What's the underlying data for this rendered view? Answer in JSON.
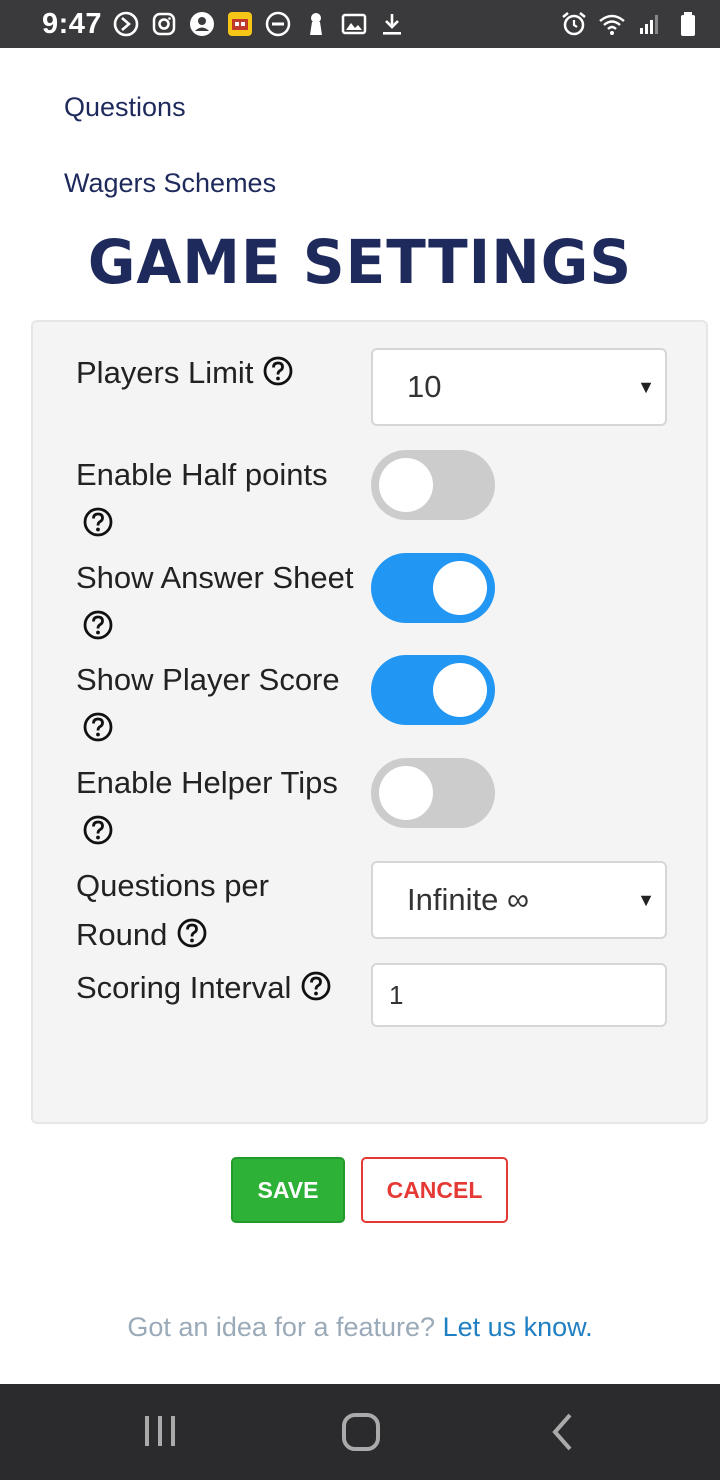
{
  "status_bar": {
    "time": "9:47",
    "left_icons": [
      "app-icon",
      "instagram-icon",
      "account-icon",
      "game-app-icon",
      "do-not-disturb-icon",
      "keyhole-icon",
      "image-icon",
      "download-icon"
    ],
    "right_icons": [
      "alarm-icon",
      "wifi-icon",
      "signal-icon",
      "battery-icon"
    ]
  },
  "nav": {
    "questions": "Questions",
    "wagers": "Wagers Schemes"
  },
  "page_title": "GAME SETTINGS",
  "settings": {
    "players_limit": {
      "label": "Players Limit",
      "value": "10"
    },
    "half_points": {
      "label": "Enable Half points",
      "enabled": false
    },
    "answer_sheet": {
      "label": "Show Answer Sheet",
      "enabled": true
    },
    "player_score": {
      "label": "Show Player Score",
      "enabled": true
    },
    "helper_tips": {
      "label": "Enable Helper Tips",
      "enabled": false
    },
    "questions_per_round": {
      "label_line1": "Questions per",
      "label_line2": "Round",
      "value": "Infinite ∞"
    },
    "scoring_interval": {
      "label": "Scoring Interval",
      "value": "1"
    }
  },
  "buttons": {
    "save": "SAVE",
    "cancel": "CANCEL"
  },
  "footer": {
    "text": "Got an idea for a feature?",
    "link": "Let us know."
  },
  "colors": {
    "toggle_on": "#2196f3",
    "toggle_off": "#cccccc",
    "save": "#2db137",
    "cancel": "#e53935",
    "title": "#1f2a5c"
  }
}
